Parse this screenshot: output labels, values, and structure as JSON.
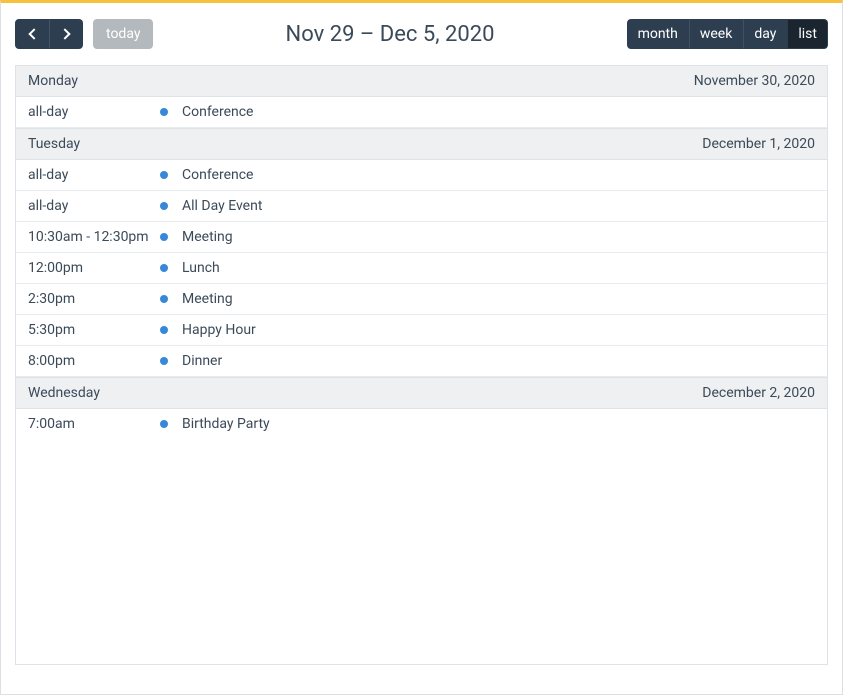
{
  "toolbar": {
    "today_label": "today",
    "title": "Nov 29 – Dec 5, 2020",
    "views": [
      {
        "key": "month",
        "label": "month",
        "active": false
      },
      {
        "key": "week",
        "label": "week",
        "active": false
      },
      {
        "key": "day",
        "label": "day",
        "active": false
      },
      {
        "key": "list",
        "label": "list",
        "active": true
      }
    ]
  },
  "event_dot_color": "#3788d8",
  "days": [
    {
      "weekday": "Monday",
      "date": "November 30, 2020",
      "events": [
        {
          "time": "all-day",
          "title": "Conference"
        }
      ]
    },
    {
      "weekday": "Tuesday",
      "date": "December 1, 2020",
      "events": [
        {
          "time": "all-day",
          "title": "Conference"
        },
        {
          "time": "all-day",
          "title": "All Day Event"
        },
        {
          "time": "10:30am - 12:30pm",
          "title": "Meeting"
        },
        {
          "time": "12:00pm",
          "title": "Lunch"
        },
        {
          "time": "2:30pm",
          "title": "Meeting"
        },
        {
          "time": "5:30pm",
          "title": "Happy Hour"
        },
        {
          "time": "8:00pm",
          "title": "Dinner"
        }
      ]
    },
    {
      "weekday": "Wednesday",
      "date": "December 2, 2020",
      "events": [
        {
          "time": "7:00am",
          "title": "Birthday Party"
        }
      ]
    }
  ]
}
